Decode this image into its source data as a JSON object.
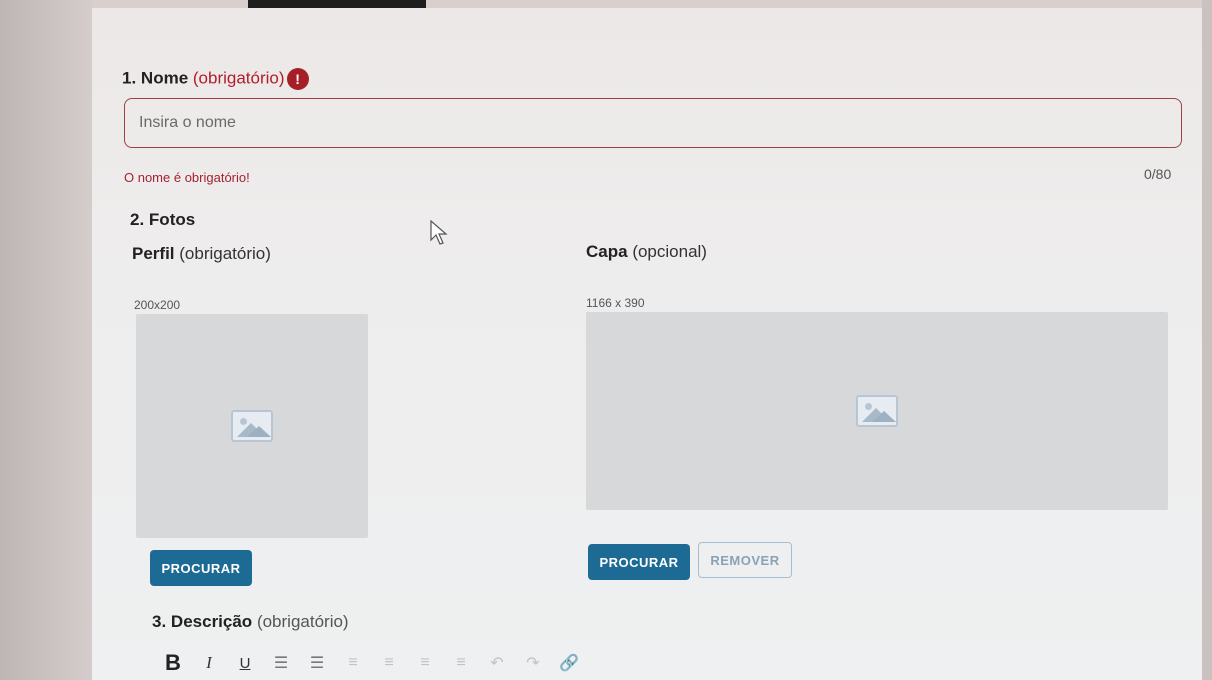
{
  "name_section": {
    "number": "1.",
    "title": "Nome",
    "required": "(obrigatório)",
    "warning_glyph": "!",
    "input_placeholder": "Insira o nome",
    "error": "O nome é obrigatório!",
    "counter": "0/80"
  },
  "photos_section": {
    "number": "2.",
    "title": "Fotos",
    "profile": {
      "title": "Perfil",
      "qualifier": "(obrigatório)",
      "dims": "200x200",
      "browse_label": "PROCURAR"
    },
    "cover": {
      "title": "Capa",
      "qualifier": "(opcional)",
      "dims": "1166 x 390",
      "browse_label": "PROCURAR",
      "remove_label": "REMOVER"
    }
  },
  "description_section": {
    "number": "3.",
    "title": "Descrição",
    "required": "(obrigatório)",
    "toolbar": [
      {
        "name": "bold-button",
        "glyph": "B"
      },
      {
        "name": "italic-button",
        "glyph": "I"
      },
      {
        "name": "underline-button",
        "glyph": "U"
      },
      {
        "name": "bullet-list-button",
        "glyph": "☰"
      },
      {
        "name": "numbered-list-button",
        "glyph": "☰"
      },
      {
        "name": "align-left-button",
        "glyph": "≡"
      },
      {
        "name": "align-center-button",
        "glyph": "≡"
      },
      {
        "name": "align-right-button",
        "glyph": "≡"
      },
      {
        "name": "align-justify-button",
        "glyph": "≡"
      },
      {
        "name": "undo-button",
        "glyph": "↶"
      },
      {
        "name": "redo-button",
        "glyph": "↷"
      },
      {
        "name": "link-button",
        "glyph": "🔗"
      }
    ]
  },
  "colors": {
    "primary": "#1d6b94",
    "error": "#a7222c",
    "warning_badge": "#a71f26"
  }
}
